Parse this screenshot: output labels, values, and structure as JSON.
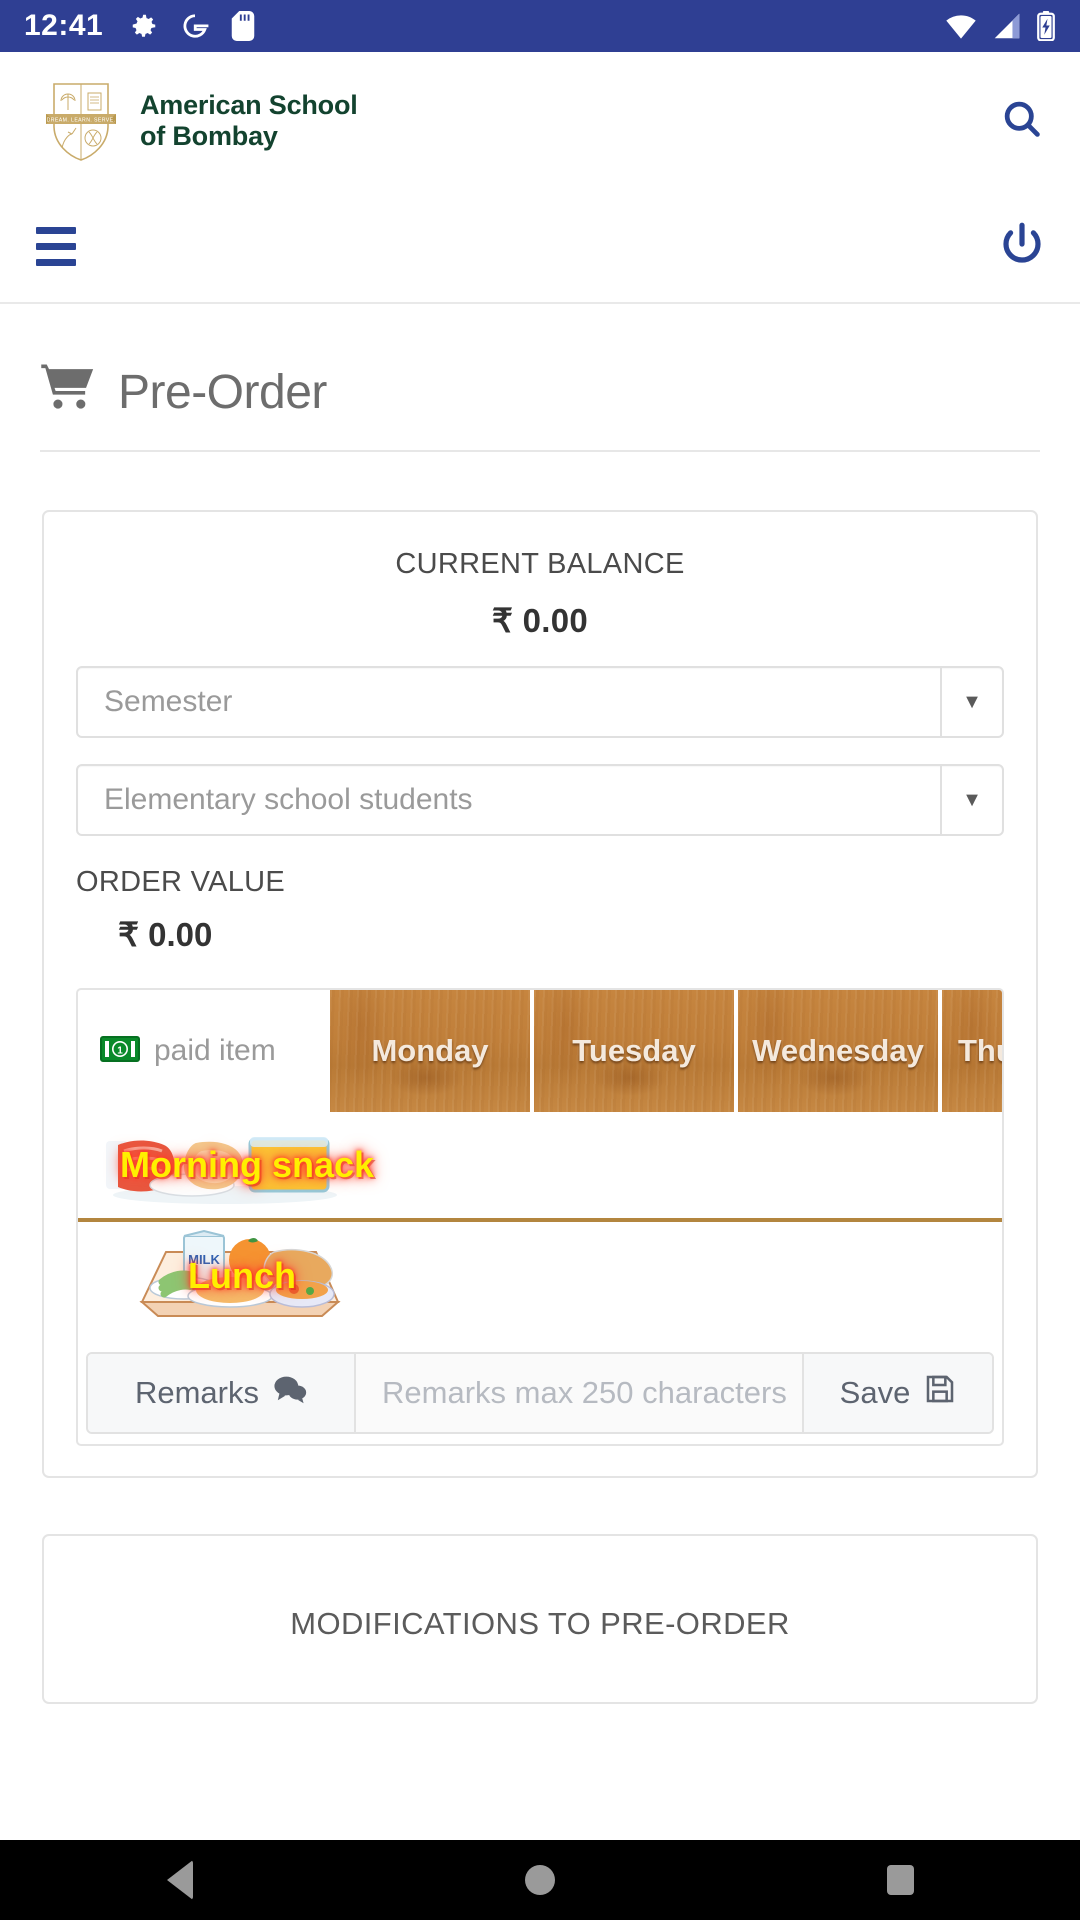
{
  "status_bar": {
    "time": "12:41",
    "left_icons": [
      "gear-icon",
      "google-g-icon",
      "sd-card-icon"
    ],
    "right_icons": [
      "wifi-icon",
      "signal-icon",
      "battery-charging-icon"
    ],
    "background_color": "#2f3f93"
  },
  "header": {
    "school_name_line1": "American School",
    "school_name_line2": "of Bombay",
    "crest_motto": "DREAM. LEARN. SERVE.",
    "search_label": "Search",
    "brand_color": "#13432f",
    "accent_color": "#2a4494"
  },
  "nav": {
    "menu_label": "Menu",
    "logout_label": "Logout"
  },
  "page": {
    "title": "Pre-Order",
    "title_icon": "shopping-cart-icon"
  },
  "balance_card": {
    "current_balance_label": "CURRENT BALANCE",
    "current_balance_value": "₹ 0.00",
    "selects": [
      {
        "name": "semester",
        "value": "Semester",
        "arrow": "▼"
      },
      {
        "name": "student-group",
        "value": "Elementary school students",
        "arrow": "▼"
      }
    ],
    "order_value_label": "ORDER VALUE",
    "order_value": "₹ 0.00"
  },
  "meal_table": {
    "paid_item_label": "paid item",
    "paid_item_icon": "money-note-icon",
    "days": [
      "Monday",
      "Tuesday",
      "Wednesday",
      "Thursday"
    ],
    "meals": [
      {
        "name": "morning-snack",
        "label": "Morning snack"
      },
      {
        "name": "lunch",
        "label": "Lunch"
      }
    ]
  },
  "remarks": {
    "label": "Remarks",
    "label_icon": "comment-icon",
    "placeholder": "Remarks max 250 characters",
    "save_label": "Save",
    "save_icon": "floppy-save-icon"
  },
  "modifications_card": {
    "title": "MODIFICATIONS TO PRE-ORDER"
  },
  "android_nav": {
    "back_label": "Back",
    "home_label": "Home",
    "recents_label": "Recents"
  }
}
